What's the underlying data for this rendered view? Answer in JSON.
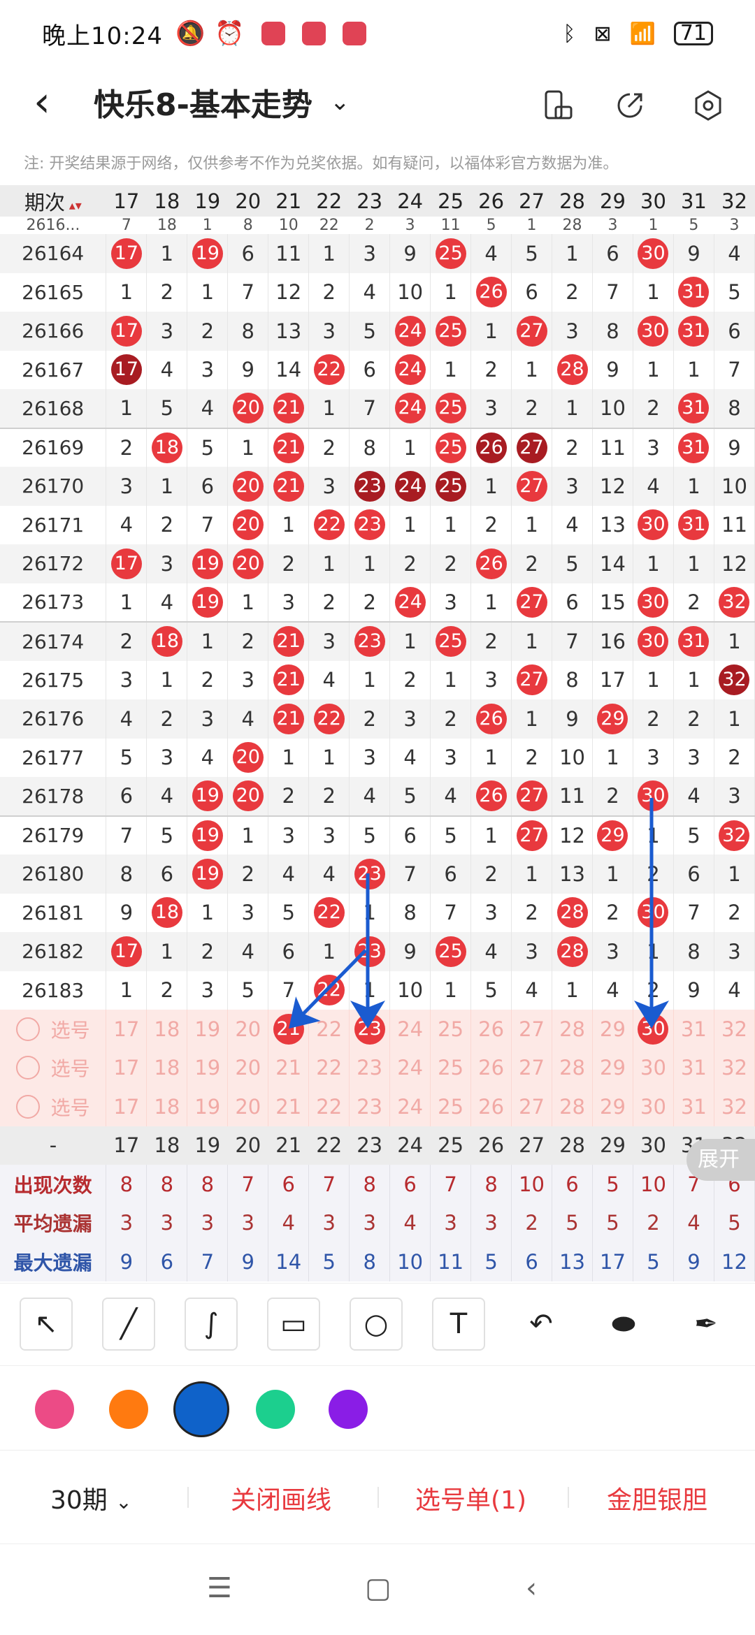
{
  "status_bar": {
    "time": "晚上10:24",
    "battery": "71"
  },
  "header": {
    "title": "快乐8-基本走势"
  },
  "notice": "注: 开奖结果源于网络，仅供参考不作为兑奖依据。如有疑问，以福体彩官方数据为准。",
  "table": {
    "period_header": "期次",
    "columns": [
      "17",
      "18",
      "19",
      "20",
      "21",
      "22",
      "23",
      "24",
      "25",
      "26",
      "27",
      "28",
      "29",
      "30",
      "31",
      "32"
    ],
    "partial_row": [
      "2616...",
      "7",
      "18",
      "1",
      "8",
      "10",
      "22",
      "2",
      "3",
      "11",
      "5",
      "1",
      "28",
      "3",
      "1",
      "5",
      "3"
    ],
    "rows": [
      {
        "period": "26164",
        "cells": [
          "17",
          "1",
          "19",
          "6",
          "11",
          "1",
          "3",
          "9",
          "25",
          "4",
          "5",
          "1",
          "6",
          "30",
          "9",
          "4"
        ]
      },
      {
        "period": "26165",
        "cells": [
          "1",
          "2",
          "1",
          "7",
          "12",
          "2",
          "4",
          "10",
          "1",
          "26",
          "6",
          "2",
          "7",
          "1",
          "31",
          "5"
        ]
      },
      {
        "period": "26166",
        "cells": [
          "17",
          "3",
          "2",
          "8",
          "13",
          "3",
          "5",
          "24",
          "25",
          "1",
          "27",
          "3",
          "8",
          "30",
          "31",
          "6"
        ]
      },
      {
        "period": "26167",
        "cells": [
          "17",
          "4",
          "3",
          "9",
          "14",
          "22",
          "6",
          "24",
          "1",
          "2",
          "1",
          "28",
          "9",
          "1",
          "1",
          "7"
        ]
      },
      {
        "period": "26168",
        "cells": [
          "1",
          "5",
          "4",
          "20",
          "21",
          "1",
          "7",
          "24",
          "25",
          "3",
          "2",
          "1",
          "10",
          "2",
          "31",
          "8"
        ]
      },
      {
        "period": "26169",
        "cells": [
          "2",
          "18",
          "5",
          "1",
          "21",
          "2",
          "8",
          "1",
          "25",
          "26",
          "27",
          "2",
          "11",
          "3",
          "31",
          "9"
        ]
      },
      {
        "period": "26170",
        "cells": [
          "3",
          "1",
          "6",
          "20",
          "21",
          "3",
          "23",
          "24",
          "25",
          "1",
          "27",
          "3",
          "12",
          "4",
          "1",
          "10"
        ]
      },
      {
        "period": "26171",
        "cells": [
          "4",
          "2",
          "7",
          "20",
          "1",
          "22",
          "23",
          "1",
          "1",
          "2",
          "1",
          "4",
          "13",
          "30",
          "31",
          "11"
        ]
      },
      {
        "period": "26172",
        "cells": [
          "17",
          "3",
          "19",
          "20",
          "2",
          "1",
          "1",
          "2",
          "2",
          "26",
          "2",
          "5",
          "14",
          "1",
          "1",
          "12"
        ]
      },
      {
        "period": "26173",
        "cells": [
          "1",
          "4",
          "19",
          "1",
          "3",
          "2",
          "2",
          "24",
          "3",
          "1",
          "27",
          "6",
          "15",
          "30",
          "2",
          "32"
        ]
      },
      {
        "period": "26174",
        "cells": [
          "2",
          "18",
          "1",
          "2",
          "21",
          "3",
          "23",
          "1",
          "25",
          "2",
          "1",
          "7",
          "16",
          "30",
          "31",
          "1"
        ]
      },
      {
        "period": "26175",
        "cells": [
          "3",
          "1",
          "2",
          "3",
          "21",
          "4",
          "1",
          "2",
          "1",
          "3",
          "27",
          "8",
          "17",
          "1",
          "1",
          "32"
        ]
      },
      {
        "period": "26176",
        "cells": [
          "4",
          "2",
          "3",
          "4",
          "21",
          "22",
          "2",
          "3",
          "2",
          "26",
          "1",
          "9",
          "29",
          "2",
          "2",
          "1"
        ]
      },
      {
        "period": "26177",
        "cells": [
          "5",
          "3",
          "4",
          "20",
          "1",
          "1",
          "3",
          "4",
          "3",
          "1",
          "2",
          "10",
          "1",
          "3",
          "3",
          "2"
        ]
      },
      {
        "period": "26178",
        "cells": [
          "6",
          "4",
          "19",
          "20",
          "2",
          "2",
          "4",
          "5",
          "4",
          "26",
          "27",
          "11",
          "2",
          "30",
          "4",
          "3"
        ]
      },
      {
        "period": "26179",
        "cells": [
          "7",
          "5",
          "19",
          "1",
          "3",
          "3",
          "5",
          "6",
          "5",
          "1",
          "27",
          "12",
          "29",
          "1",
          "5",
          "32"
        ]
      },
      {
        "period": "26180",
        "cells": [
          "8",
          "6",
          "19",
          "2",
          "4",
          "4",
          "23",
          "7",
          "6",
          "2",
          "1",
          "13",
          "1",
          "2",
          "6",
          "1"
        ]
      },
      {
        "period": "26181",
        "cells": [
          "9",
          "18",
          "1",
          "3",
          "5",
          "22",
          "1",
          "8",
          "7",
          "3",
          "2",
          "28",
          "2",
          "30",
          "7",
          "2"
        ]
      },
      {
        "period": "26182",
        "cells": [
          "17",
          "1",
          "2",
          "4",
          "6",
          "1",
          "23",
          "9",
          "25",
          "4",
          "3",
          "28",
          "3",
          "1",
          "8",
          "3"
        ]
      },
      {
        "period": "26183",
        "cells": [
          "1",
          "2",
          "3",
          "5",
          "7",
          "22",
          "1",
          "10",
          "1",
          "5",
          "4",
          "1",
          "4",
          "2",
          "9",
          "4"
        ]
      }
    ],
    "select_label": "选号",
    "select_rows": [
      [
        "17",
        "18",
        "19",
        "20",
        "21",
        "22",
        "23",
        "24",
        "25",
        "26",
        "27",
        "28",
        "29",
        "30",
        "31",
        "32"
      ],
      [
        "17",
        "18",
        "19",
        "20",
        "21",
        "22",
        "23",
        "24",
        "25",
        "26",
        "27",
        "28",
        "29",
        "30",
        "31",
        "32"
      ],
      [
        "17",
        "18",
        "19",
        "20",
        "21",
        "22",
        "23",
        "24",
        "25",
        "26",
        "27",
        "28",
        "29",
        "30",
        "31",
        "32"
      ]
    ],
    "footer_header_label": "-",
    "stats": [
      {
        "label": "出现次数",
        "values": [
          "8",
          "8",
          "8",
          "7",
          "6",
          "7",
          "8",
          "6",
          "7",
          "8",
          "10",
          "6",
          "5",
          "10",
          "7",
          "6"
        ]
      },
      {
        "label": "平均遗漏",
        "values": [
          "3",
          "3",
          "3",
          "3",
          "4",
          "3",
          "3",
          "4",
          "3",
          "3",
          "2",
          "5",
          "5",
          "2",
          "4",
          "5"
        ]
      },
      {
        "label": "最大遗漏",
        "values": [
          "9",
          "6",
          "7",
          "9",
          "14",
          "5",
          "8",
          "10",
          "11",
          "5",
          "6",
          "13",
          "17",
          "5",
          "9",
          "12"
        ]
      }
    ]
  },
  "expand_label": "展开",
  "tools": [
    "arrow-tool",
    "line-tool",
    "curve-tool",
    "rect-tool",
    "circle-tool",
    "text-tool",
    "undo-tool",
    "eraser-tool",
    "clear-tool"
  ],
  "colors": [
    "#ec4b86",
    "#ff7a10",
    "#0f62c9",
    "#1ccf8e",
    "#8a1de6"
  ],
  "selected_color": "#0f62c9",
  "bottom_bar": {
    "period_select": "30期",
    "close_lines": "关闭画线",
    "selection": "选号单(1)",
    "golden": "金胆银胆"
  }
}
